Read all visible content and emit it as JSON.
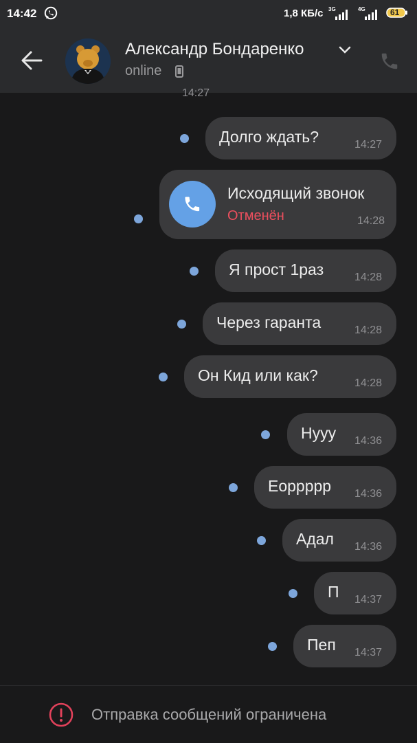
{
  "status_bar": {
    "time": "14:42",
    "speed": "1,8 КБ/с",
    "net1": "3G",
    "net2": "4G",
    "battery": "61"
  },
  "header": {
    "contact_name": "Александр Бондаренко",
    "presence": "online"
  },
  "messages": [
    {
      "text": "",
      "time": "14:27"
    },
    {
      "text": "Долго ждать?",
      "time": "14:27"
    },
    {
      "text": "Я прост 1раз",
      "time": "14:28"
    },
    {
      "text": "Через гаранта",
      "time": "14:28"
    },
    {
      "text": "Он Кид или как?",
      "time": "14:28"
    },
    {
      "text": "Нууу",
      "time": "14:36"
    },
    {
      "text": "Еорpppp",
      "time": "14:36"
    },
    {
      "text": "Адал",
      "time": "14:36"
    },
    {
      "text": "П",
      "time": "14:37"
    },
    {
      "text": "Пеп",
      "time": "14:37"
    }
  ],
  "call_message": {
    "title": "Исходящий звонок",
    "status": "Отменён",
    "time": "14:28"
  },
  "footer": {
    "restriction_text": "Отправка сообщений ограничена"
  },
  "colors": {
    "background": "#19191a",
    "bar": "#2a2b2d",
    "bubble": "#3a3a3c",
    "unread_dot": "#7da6db",
    "call_accent": "#64a1e6",
    "cancel_red": "#ec4f5e",
    "warning_red": "#e0415a"
  }
}
